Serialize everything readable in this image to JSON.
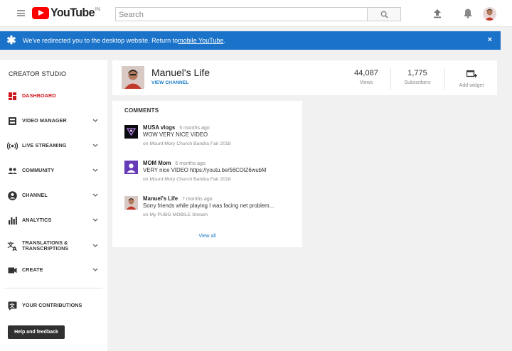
{
  "topbar": {
    "logo_text": "YouTube",
    "country_code": "IN",
    "search_placeholder": "Search"
  },
  "banner": {
    "text": "We've redirected you to the desktop website. Return to ",
    "link_text": "mobile YouTube",
    "trailing": ".",
    "close": "×"
  },
  "sidebar": {
    "title": "CREATOR STUDIO",
    "items": [
      {
        "label": "DASHBOARD",
        "icon": "dashboard-icon",
        "active": true
      },
      {
        "label": "VIDEO MANAGER",
        "icon": "video-manager-icon"
      },
      {
        "label": "LIVE STREAMING",
        "icon": "live-streaming-icon"
      },
      {
        "label": "COMMUNITY",
        "icon": "community-icon"
      },
      {
        "label": "CHANNEL",
        "icon": "channel-icon"
      },
      {
        "label": "ANALYTICS",
        "icon": "analytics-icon"
      },
      {
        "label": "TRANSLATIONS & TRANSCRIPTIONS",
        "icon": "translate-icon"
      },
      {
        "label": "CREATE",
        "icon": "create-icon"
      }
    ],
    "contributions_label": "YOUR CONTRIBUTIONS",
    "help_label": "Help and feedback"
  },
  "channel": {
    "name": "Manuel's Life",
    "view_channel": "VIEW CHANNEL",
    "stats": [
      {
        "value": "44,087",
        "label": "Views"
      },
      {
        "value": "1,775",
        "label": "Subscribers"
      }
    ],
    "add_widget": "Add widget"
  },
  "comments": {
    "title": "COMMENTS",
    "items": [
      {
        "author": "MUSA vlogs",
        "time": "5 months ago",
        "text": "WOW VERY NICE VIDEO",
        "video": "on Mount Mory Church Bandra Fair 2018"
      },
      {
        "author": "MOM Mom",
        "time": "6 months ago",
        "text": "VERY nice VIDEO https://youtu.be/56COlZ6wubM",
        "video": "on Mount Mory Church Bandra Fair 2018"
      },
      {
        "author": "Manuel's Life",
        "time": "7 months ago",
        "text": "Sorry friends while playing I was facing net problem...",
        "video": "on My PUBG MOBILE Stream"
      }
    ],
    "view_all": "View all"
  },
  "colors": {
    "brand_red": "#ff0000",
    "banner_blue": "#1a73c9",
    "link_blue": "#167ac6",
    "active_red": "#cc181e"
  }
}
